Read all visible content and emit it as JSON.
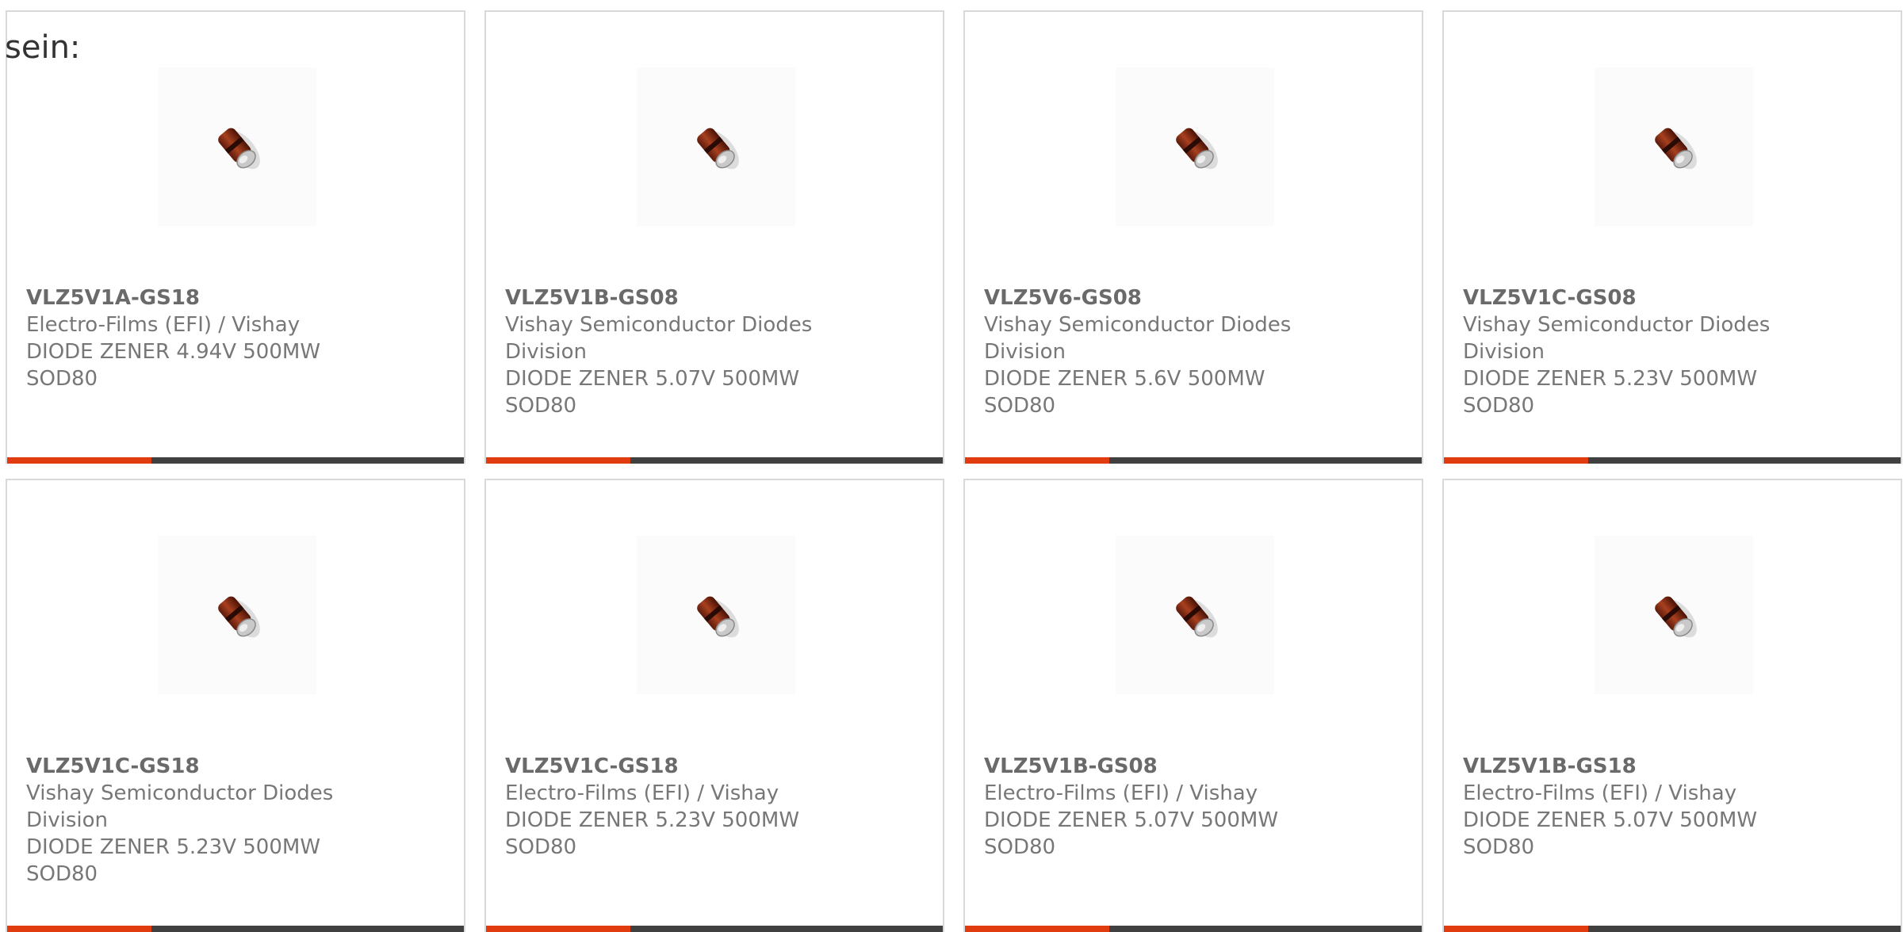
{
  "heading": "sein:",
  "colors": {
    "accent": "#e03c0f",
    "bar": "#404040",
    "text": "#777777",
    "border": "#d9d9d9"
  },
  "product_image_icon": "sod80-diode-icon",
  "products": [
    {
      "part_number": "VLZ5V1A-GS18",
      "manufacturer": "Electro-Films (EFI) / Vishay",
      "description": "DIODE ZENER 4.94V 500MW",
      "package": "SOD80"
    },
    {
      "part_number": "VLZ5V1B-GS08",
      "manufacturer": "Vishay Semiconductor Diodes Division",
      "description": "DIODE ZENER 5.07V 500MW",
      "package": "SOD80"
    },
    {
      "part_number": "VLZ5V6-GS08",
      "manufacturer": "Vishay Semiconductor Diodes Division",
      "description": "DIODE ZENER 5.6V 500MW",
      "package": "SOD80"
    },
    {
      "part_number": "VLZ5V1C-GS08",
      "manufacturer": "Vishay Semiconductor Diodes Division",
      "description": "DIODE ZENER 5.23V 500MW",
      "package": "SOD80"
    },
    {
      "part_number": "VLZ5V1C-GS18",
      "manufacturer": "Vishay Semiconductor Diodes Division",
      "description": "DIODE ZENER 5.23V 500MW",
      "package": "SOD80"
    },
    {
      "part_number": "VLZ5V1C-GS18",
      "manufacturer": "Electro-Films (EFI) / Vishay",
      "description": "DIODE ZENER 5.23V 500MW",
      "package": "SOD80"
    },
    {
      "part_number": "VLZ5V1B-GS08",
      "manufacturer": "Electro-Films (EFI) / Vishay",
      "description": "DIODE ZENER 5.07V 500MW",
      "package": "SOD80"
    },
    {
      "part_number": "VLZ5V1B-GS18",
      "manufacturer": "Electro-Films (EFI) / Vishay",
      "description": "DIODE ZENER 5.07V 500MW",
      "package": "SOD80"
    }
  ]
}
